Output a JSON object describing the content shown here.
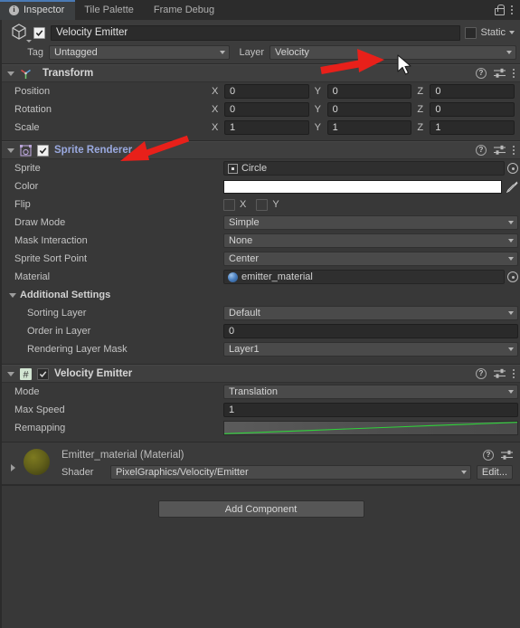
{
  "tabs": [
    {
      "label": "Inspector",
      "icon": "info-icon",
      "active": true
    },
    {
      "label": "Tile Palette",
      "active": false
    },
    {
      "label": "Frame Debug",
      "active": false
    }
  ],
  "tabbar_icons": {
    "lock": "lock-icon",
    "menu": "kebab-menu-icon"
  },
  "gameobject": {
    "name": "Velocity Emitter",
    "enabled": true,
    "static_label": "Static",
    "static_checked": false,
    "tag_label": "Tag",
    "tag_value": "Untagged",
    "layer_label": "Layer",
    "layer_value": "Velocity"
  },
  "transform": {
    "title": "Transform",
    "rows": [
      {
        "label": "Position",
        "x": "0",
        "y": "0",
        "z": "0"
      },
      {
        "label": "Rotation",
        "x": "0",
        "y": "0",
        "z": "0"
      },
      {
        "label": "Scale",
        "x": "1",
        "y": "1",
        "z": "1"
      }
    ],
    "axes": {
      "x": "X",
      "y": "Y",
      "z": "Z"
    }
  },
  "sprite_renderer": {
    "title": "Sprite Renderer",
    "enabled": true,
    "sprite_label": "Sprite",
    "sprite_value": "Circle",
    "color_label": "Color",
    "color_value": "#ffffff",
    "flip_label": "Flip",
    "flip_x": "X",
    "flip_y": "Y",
    "draw_mode_label": "Draw Mode",
    "draw_mode_value": "Simple",
    "mask_label": "Mask Interaction",
    "mask_value": "None",
    "sort_point_label": "Sprite Sort Point",
    "sort_point_value": "Center",
    "material_label": "Material",
    "material_value": "emitter_material",
    "additional_label": "Additional Settings",
    "sorting_layer_label": "Sorting Layer",
    "sorting_layer_value": "Default",
    "order_label": "Order in Layer",
    "order_value": "0",
    "render_mask_label": "Rendering Layer Mask",
    "render_mask_value": "Layer1"
  },
  "velocity_emitter": {
    "title": "Velocity Emitter",
    "enabled": true,
    "mode_label": "Mode",
    "mode_value": "Translation",
    "max_speed_label": "Max Speed",
    "max_speed_value": "1",
    "remapping_label": "Remapping",
    "curve_color": "#2fd23a"
  },
  "material_asset": {
    "title": "Emitter_material (Material)",
    "shader_label": "Shader",
    "shader_value": "PixelGraphics/Velocity/Emitter",
    "edit_label": "Edit..."
  },
  "footer": {
    "add_component_label": "Add Component"
  },
  "chart_data": {
    "type": "line",
    "title": "Remapping",
    "x": [
      0,
      0.1,
      0.2,
      0.3,
      0.4,
      0.5,
      0.6,
      0.7,
      0.8,
      0.9,
      1.0
    ],
    "values": [
      0.05,
      0.14,
      0.23,
      0.32,
      0.41,
      0.5,
      0.59,
      0.68,
      0.77,
      0.86,
      0.95
    ],
    "xlabel": "",
    "ylabel": "",
    "xlim": [
      0,
      1
    ],
    "ylim": [
      0,
      1
    ],
    "line_color": "#2fd23a",
    "grid": false,
    "legend": false
  }
}
